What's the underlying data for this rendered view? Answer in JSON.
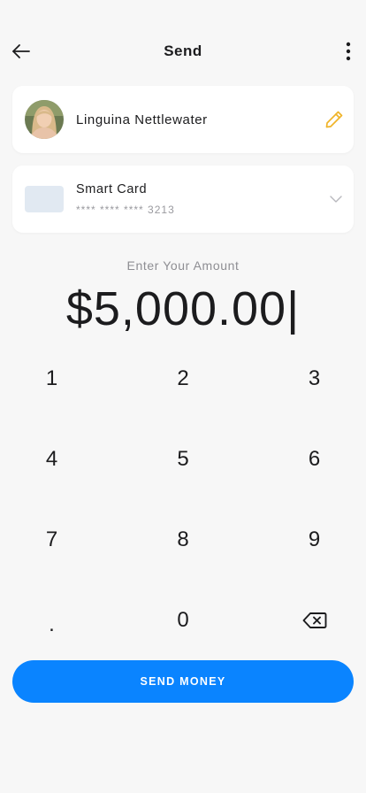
{
  "header": {
    "title": "Send",
    "back_icon": "arrow-left-icon",
    "more_icon": "more-vertical-icon"
  },
  "recipient": {
    "name": "Linguina Nettlewater",
    "edit_icon": "pencil-icon",
    "edit_icon_color": "#f0b429"
  },
  "payment_method": {
    "name": "Smart Card",
    "number": "**** **** **** 3213",
    "dropdown_icon": "chevron-down-icon"
  },
  "amount": {
    "label": "Enter Your Amount",
    "value": "$5,000.00|"
  },
  "keypad": {
    "keys": [
      "1",
      "2",
      "3",
      "4",
      "5",
      "6",
      "7",
      "8",
      "9",
      ".",
      "0"
    ],
    "backspace_icon": "backspace-icon"
  },
  "actions": {
    "send_label": "SEND MONEY",
    "accent_color": "#0a84ff"
  }
}
